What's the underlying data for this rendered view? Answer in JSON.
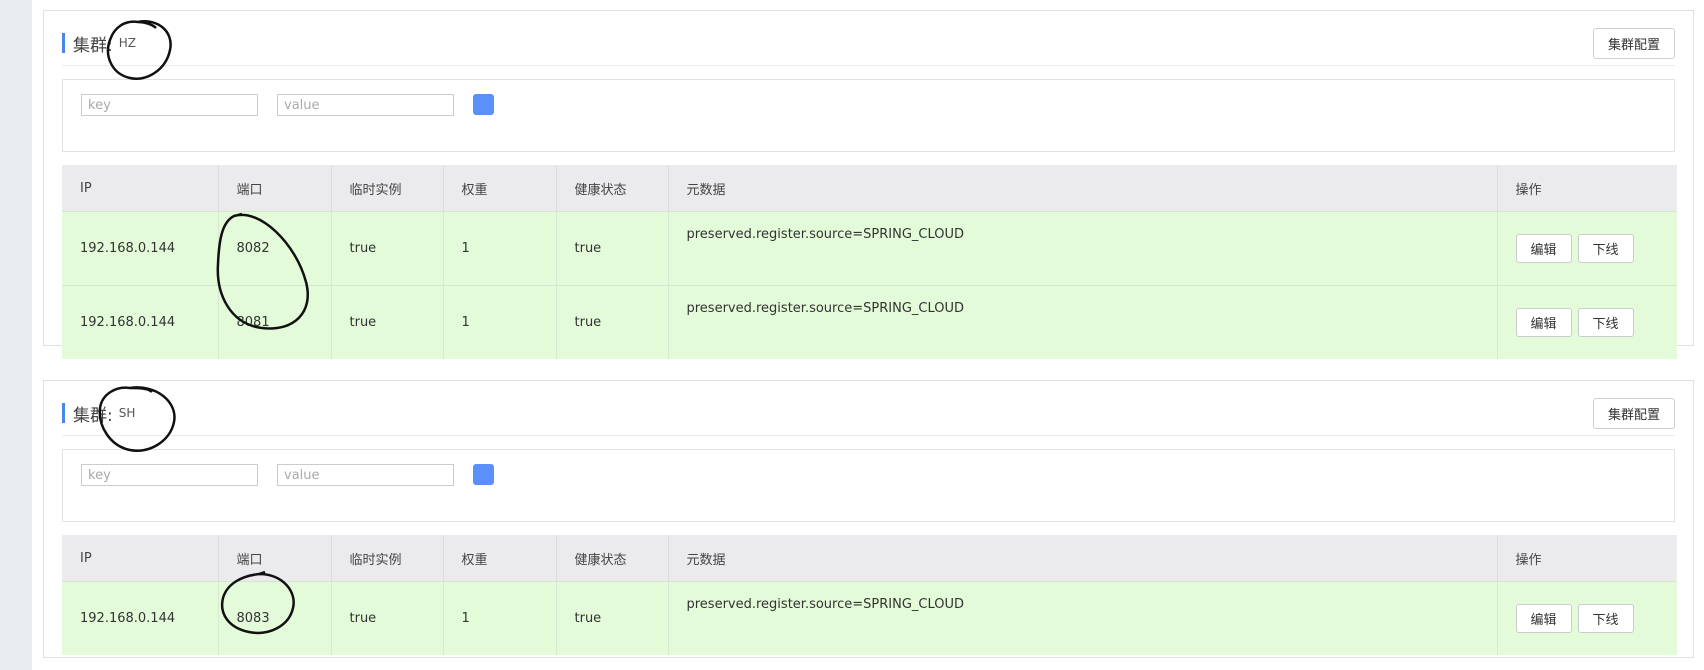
{
  "clusters": [
    {
      "label": "集群:",
      "name": "HZ",
      "config_button": "集群配置",
      "filter": {
        "key_placeholder": "key",
        "value_placeholder": "value"
      },
      "columns": [
        "IP",
        "端口",
        "临时实例",
        "权重",
        "健康状态",
        "元数据",
        "操作"
      ],
      "rows": [
        {
          "ip": "192.168.0.144",
          "port": "8082",
          "ephemeral": "true",
          "weight": "1",
          "healthy": "true",
          "metadata": "preserved.register.source=SPRING_CLOUD",
          "edit": "编辑",
          "offline": "下线"
        },
        {
          "ip": "192.168.0.144",
          "port": "8081",
          "ephemeral": "true",
          "weight": "1",
          "healthy": "true",
          "metadata": "preserved.register.source=SPRING_CLOUD",
          "edit": "编辑",
          "offline": "下线"
        }
      ]
    },
    {
      "label": "集群:",
      "name": "SH",
      "config_button": "集群配置",
      "filter": {
        "key_placeholder": "key",
        "value_placeholder": "value"
      },
      "columns": [
        "IP",
        "端口",
        "临时实例",
        "权重",
        "健康状态",
        "元数据",
        "操作"
      ],
      "rows": [
        {
          "ip": "192.168.0.144",
          "port": "8083",
          "ephemeral": "true",
          "weight": "1",
          "healthy": "true",
          "metadata": "preserved.register.source=SPRING_CLOUD",
          "edit": "编辑",
          "offline": "下线"
        }
      ]
    }
  ],
  "colors": {
    "accent": "#5b8ff9",
    "row_bg": "#e3fbd9",
    "header_bg": "#ebebee"
  },
  "icons": [
    "add-filter-icon",
    "hand-drawn-circle-annotation"
  ]
}
